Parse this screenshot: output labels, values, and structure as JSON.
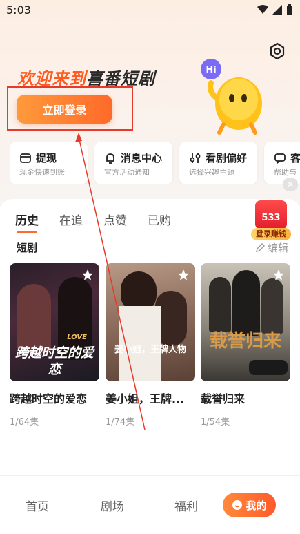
{
  "status": {
    "time": "5:03"
  },
  "header": {
    "welcome_accent": "欢迎来到",
    "welcome_dark": "喜番短剧",
    "login_label": "立即登录",
    "mascot_bubble": "Hi"
  },
  "shortcuts": [
    {
      "title": "提现",
      "sub": "现金快速到账",
      "icon": "wallet-icon"
    },
    {
      "title": "消息中心",
      "sub": "官方活动通知",
      "icon": "bell-icon"
    },
    {
      "title": "看剧偏好",
      "sub": "选择兴趣主题",
      "icon": "preference-icon"
    },
    {
      "title": "客",
      "sub": "帮助与",
      "icon": "service-icon"
    }
  ],
  "tabs": [
    "历史",
    "在追",
    "点赞",
    "已购"
  ],
  "reward": {
    "count": "533",
    "label": "登录赚钱"
  },
  "section": {
    "label": "短剧",
    "edit": "编辑"
  },
  "dramas": [
    {
      "title": "跨越时空的爱恋",
      "eps": "1/64集",
      "poster_text": "跨越时空的爱恋",
      "poster_small": "LOVE"
    },
    {
      "title": "姜小姐，王牌...",
      "eps": "1/74集",
      "poster_text": "姜小姐，王牌人物"
    },
    {
      "title": "载誉归来",
      "eps": "1/54集",
      "poster_text": "载誉归来"
    }
  ],
  "nav": {
    "home": "首页",
    "theater": "剧场",
    "welfare": "福利",
    "mine": "我的"
  },
  "colors": {
    "accent": "#ff6a2a",
    "annotation": "#e83a2a"
  }
}
